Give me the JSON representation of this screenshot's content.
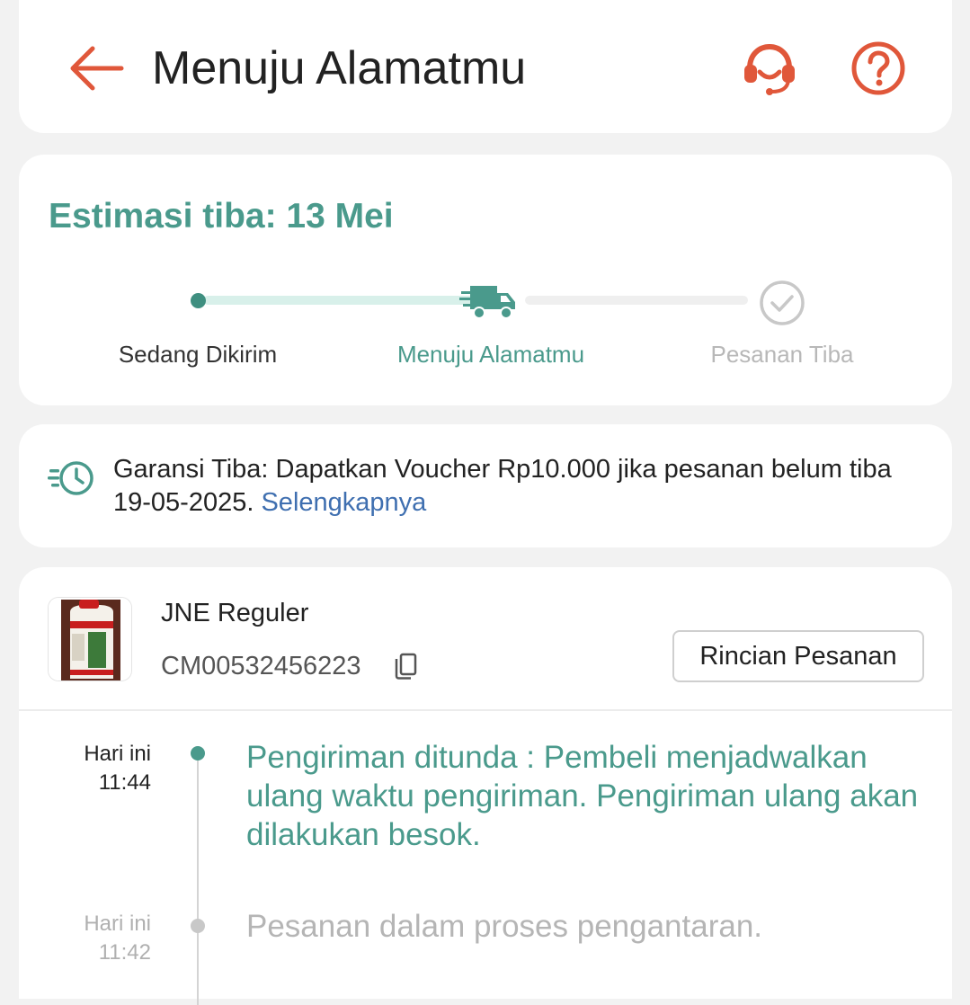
{
  "header": {
    "title": "Menuju Alamatmu",
    "back_icon": "arrow-left-icon",
    "support_icon": "headset-icon",
    "help_icon": "question-circle-icon",
    "accent_color": "#e0573a"
  },
  "estimate": {
    "title": "Estimasi tiba: 13 Mei",
    "steps": [
      {
        "label": "Sedang Dikirim",
        "state": "done"
      },
      {
        "label": "Menuju Alamatmu",
        "state": "current",
        "icon": "truck-icon"
      },
      {
        "label": "Pesanan Tiba",
        "state": "pending",
        "icon": "check-circle-icon"
      }
    ],
    "accent_color": "#4a9a8c"
  },
  "guarantee": {
    "icon": "fast-clock-icon",
    "text": "Garansi Tiba: Dapatkan Voucher Rp10.000 jika pesanan belum tiba 19-05-2025.",
    "link": "Selengkapnya"
  },
  "shipment": {
    "courier": "JNE Reguler",
    "tracking_number": "CM00532456223",
    "copy_icon": "copy-icon",
    "detail_button": "Rincian Pesanan",
    "product_thumb": "product-bottle-image"
  },
  "timeline": [
    {
      "day": "Hari ini",
      "time": "11:44",
      "text": "Pengiriman ditunda : Pembeli menjadwalkan ulang waktu pengiriman. Pengiriman ulang akan dilakukan besok.",
      "active": true
    },
    {
      "day": "Hari ini",
      "time": "11:42",
      "text": "Pesanan dalam proses pengantaran.",
      "active": false
    }
  ]
}
